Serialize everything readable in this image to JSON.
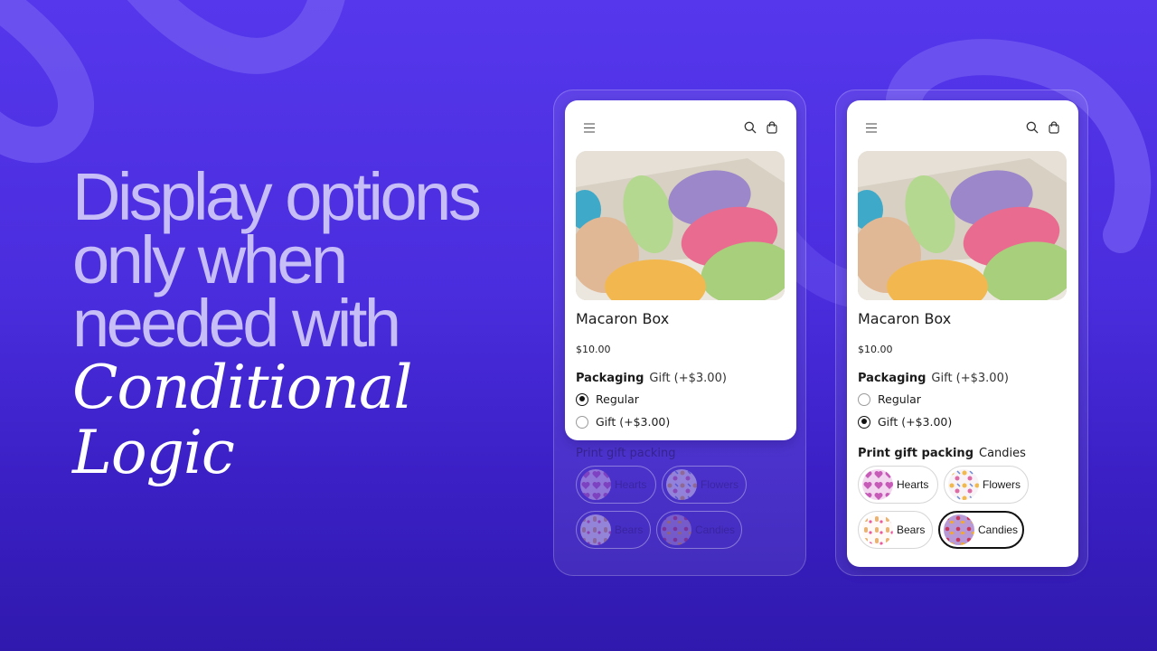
{
  "headline": {
    "lines": [
      "Display options",
      "only when",
      "needed with"
    ],
    "italic_lines": [
      "Conditional",
      "Logic"
    ]
  },
  "colors": {
    "background_top": "#5637ec",
    "background_bottom": "#2f19ad",
    "headline_text": "#c7bdf7",
    "headline_italic": "#ffffff",
    "selected_border": "#111111"
  },
  "phones": [
    {
      "state": "regular-selected",
      "header": {
        "icons": [
          "menu-icon",
          "search-icon",
          "shopping-bag-icon"
        ]
      },
      "product": {
        "title": "Macaron Box",
        "price": "$10.00"
      },
      "packaging": {
        "label": "Packaging",
        "selected_value": "Gift (+$3.00)",
        "options": [
          {
            "label": "Regular",
            "checked": true
          },
          {
            "label": "Gift (+$3.00)",
            "checked": false
          }
        ]
      },
      "gift_print": {
        "label": "Print gift packing",
        "selected_value": "",
        "hidden": true,
        "options": [
          {
            "label": "Hearts",
            "selected": false
          },
          {
            "label": "Flowers",
            "selected": false
          },
          {
            "label": "Bears",
            "selected": false
          },
          {
            "label": "Candies",
            "selected": false
          }
        ]
      }
    },
    {
      "state": "gift-selected",
      "header": {
        "icons": [
          "menu-icon",
          "search-icon",
          "shopping-bag-icon"
        ]
      },
      "product": {
        "title": "Macaron Box",
        "price": "$10.00"
      },
      "packaging": {
        "label": "Packaging",
        "selected_value": "Gift (+$3.00)",
        "options": [
          {
            "label": "Regular",
            "checked": false
          },
          {
            "label": "Gift (+$3.00)",
            "checked": true
          }
        ]
      },
      "gift_print": {
        "label": "Print gift packing",
        "selected_value": "Candies",
        "hidden": false,
        "options": [
          {
            "label": "Hearts",
            "selected": false
          },
          {
            "label": "Flowers",
            "selected": false
          },
          {
            "label": "Bears",
            "selected": false
          },
          {
            "label": "Candies",
            "selected": true
          }
        ]
      }
    }
  ]
}
